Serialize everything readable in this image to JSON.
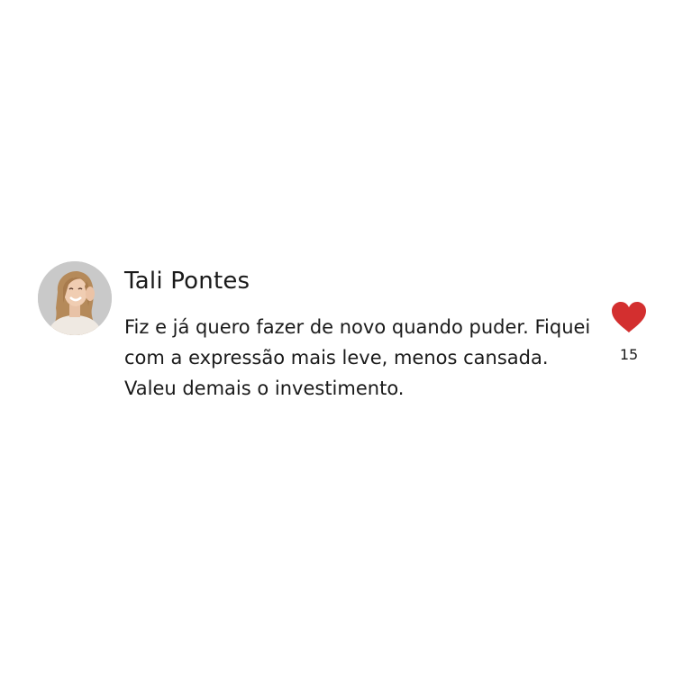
{
  "comment": {
    "author": "Tali Pontes",
    "text": "Fiz e já quero fazer de novo quando puder. Fiquei com a expressão mais leve, menos cansada. Valeu demais o investimento.",
    "likes": "15",
    "avatar_icon": "user-avatar",
    "like_icon": "heart-icon",
    "heart_color": "#d32f2f"
  }
}
